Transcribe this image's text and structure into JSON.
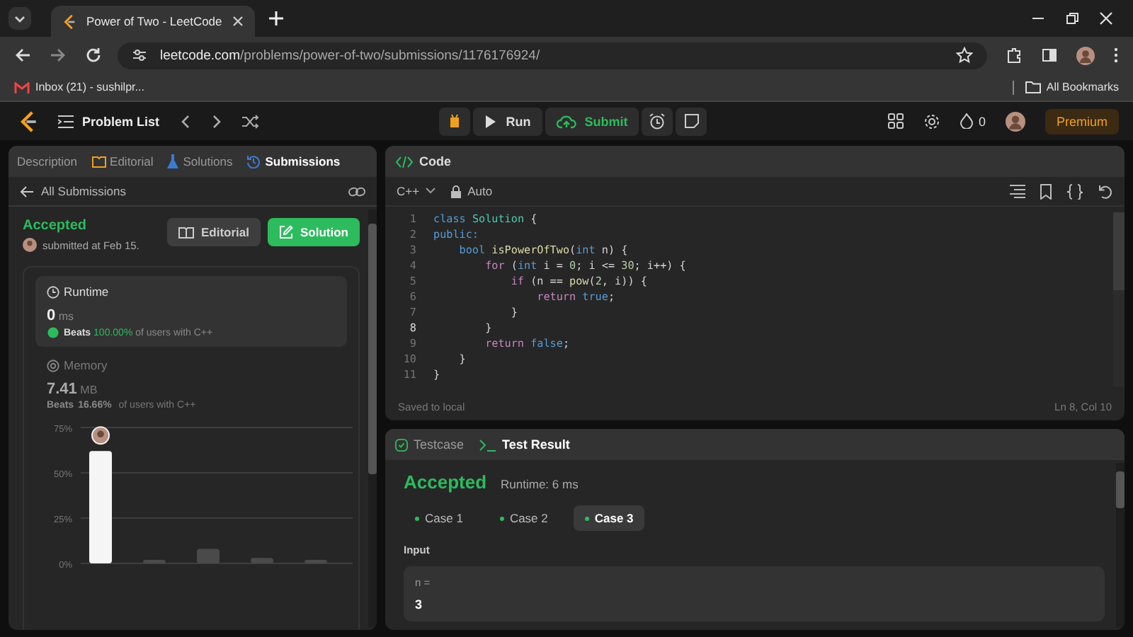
{
  "browser": {
    "tab_title": "Power of Two - LeetCode",
    "url_host": "leetcode.com",
    "url_path": "/problems/power-of-two/submissions/1176176924/",
    "bookmarks": [
      {
        "label": "Inbox (21) - sushilpr..."
      }
    ],
    "all_bookmarks": "All Bookmarks"
  },
  "nav": {
    "problem_list": "Problem List",
    "run": "Run",
    "submit": "Submit",
    "streak": "0",
    "premium": "Premium"
  },
  "left": {
    "tabs": [
      {
        "label": "Description",
        "selected": false
      },
      {
        "label": "Editorial",
        "selected": false
      },
      {
        "label": "Solutions",
        "selected": false
      },
      {
        "label": "Submissions",
        "selected": true
      }
    ],
    "back": "All Submissions",
    "status": "Accepted",
    "submitted": "submitted at Feb 15.",
    "editorial_button": "Editorial",
    "solution_button": "Solution",
    "runtime": {
      "title": "Runtime",
      "value": "0",
      "unit": "ms",
      "beats_label": "Beats",
      "beats": "100.00%",
      "suffix": "of users with C++"
    },
    "memory": {
      "title": "Memory",
      "value": "7.41",
      "unit": "MB",
      "beats_label": "Beats",
      "beats": "16.66%",
      "suffix": "of users with C++",
      "chart_data": {
        "type": "bar",
        "values": [
          62,
          2,
          8,
          3,
          2
        ],
        "ylim": [
          0,
          75
        ],
        "yticks": [
          {
            "value": 0,
            "label": "0%"
          },
          {
            "value": 25,
            "label": "25%"
          },
          {
            "value": 50,
            "label": "50%"
          },
          {
            "value": 75,
            "label": "75%"
          }
        ]
      }
    }
  },
  "code": {
    "title": "Code",
    "language": "C++",
    "mode": "Auto",
    "saved": "Saved to local",
    "cursor": "Ln 8, Col 10",
    "lines": [
      {
        "number": "1",
        "current": false,
        "tokens": [
          {
            "t": "class ",
            "kind": "keyword"
          },
          {
            "t": "Solution",
            "kind": "type"
          },
          {
            "t": " {",
            "kind": "plain"
          }
        ]
      },
      {
        "number": "2",
        "current": false,
        "tokens": [
          {
            "t": "public:",
            "kind": "keyword"
          }
        ]
      },
      {
        "number": "3",
        "current": false,
        "tokens": [
          {
            "t": "    bool ",
            "kind": "keyword"
          },
          {
            "t": "isPowerOfTwo",
            "kind": "function"
          },
          {
            "t": "(",
            "kind": "plain"
          },
          {
            "t": "int",
            "kind": "keyword"
          },
          {
            "t": " n) {",
            "kind": "plain"
          }
        ]
      },
      {
        "number": "4",
        "current": false,
        "tokens": [
          {
            "t": "        for",
            "kind": "control"
          },
          {
            "t": " (",
            "kind": "plain"
          },
          {
            "t": "int",
            "kind": "keyword"
          },
          {
            "t": " i = ",
            "kind": "plain"
          },
          {
            "t": "0",
            "kind": "number"
          },
          {
            "t": "; i <= ",
            "kind": "plain"
          },
          {
            "t": "30",
            "kind": "number"
          },
          {
            "t": "; i++) {",
            "kind": "plain"
          }
        ]
      },
      {
        "number": "5",
        "current": false,
        "tokens": [
          {
            "t": "            if",
            "kind": "control"
          },
          {
            "t": " (n == ",
            "kind": "plain"
          },
          {
            "t": "pow",
            "kind": "function"
          },
          {
            "t": "(",
            "kind": "plain"
          },
          {
            "t": "2",
            "kind": "number"
          },
          {
            "t": ", i)) {",
            "kind": "plain"
          }
        ]
      },
      {
        "number": "6",
        "current": false,
        "tokens": [
          {
            "t": "                return ",
            "kind": "control"
          },
          {
            "t": "true",
            "kind": "keyword"
          },
          {
            "t": ";",
            "kind": "plain"
          }
        ]
      },
      {
        "number": "7",
        "current": false,
        "tokens": [
          {
            "t": "            }",
            "kind": "plain"
          }
        ]
      },
      {
        "number": "8",
        "current": true,
        "tokens": [
          {
            "t": "        }",
            "kind": "plain"
          }
        ]
      },
      {
        "number": "9",
        "current": false,
        "tokens": [
          {
            "t": "        return ",
            "kind": "control"
          },
          {
            "t": "false",
            "kind": "keyword"
          },
          {
            "t": ";",
            "kind": "plain"
          }
        ]
      },
      {
        "number": "10",
        "current": false,
        "tokens": [
          {
            "t": "    }",
            "kind": "plain"
          }
        ]
      },
      {
        "number": "11",
        "current": false,
        "tokens": [
          {
            "t": "}",
            "kind": "plain"
          }
        ]
      }
    ]
  },
  "result": {
    "tabs": [
      {
        "label": "Testcase",
        "selected": false
      },
      {
        "label": "Test Result",
        "selected": true
      }
    ],
    "status": "Accepted",
    "runtime": "Runtime: 6 ms",
    "cases": [
      {
        "label": "Case 1",
        "selected": false
      },
      {
        "label": "Case 2",
        "selected": false
      },
      {
        "label": "Case 3",
        "selected": true
      }
    ],
    "input_label": "Input",
    "var": "n =",
    "value": "3"
  }
}
